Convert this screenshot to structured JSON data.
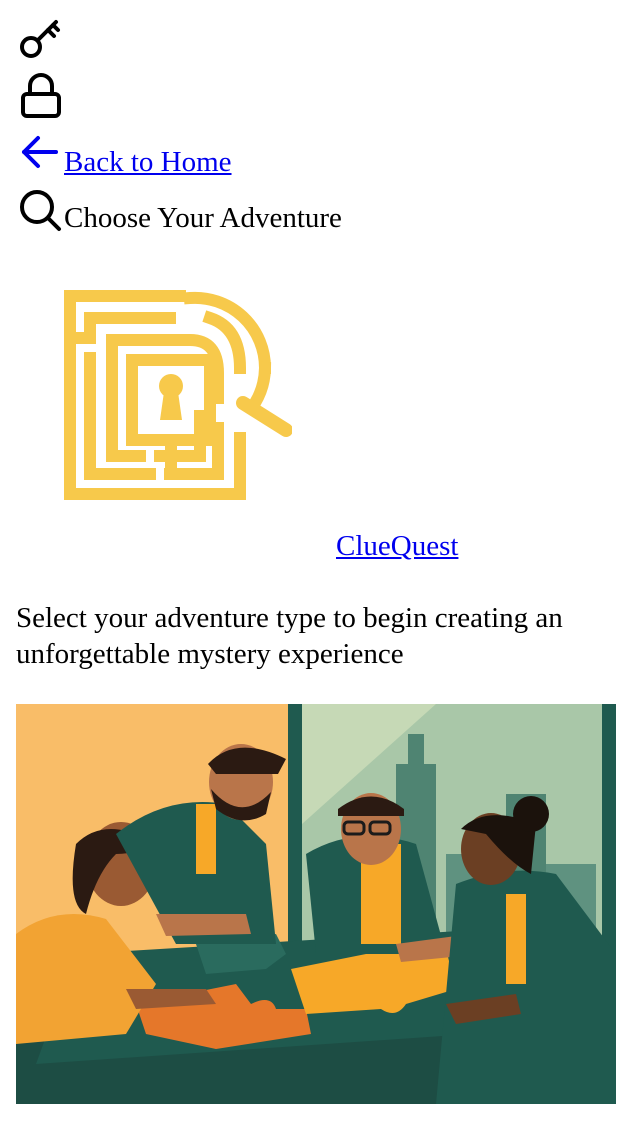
{
  "nav": {
    "back_label": "Back to Home",
    "section_title": "Choose Your Adventure"
  },
  "icons": {
    "key": "key-icon",
    "lock": "lock-icon",
    "back": "arrow-left-icon",
    "search": "search-icon"
  },
  "brand": {
    "name": "ClueQuest",
    "logo_color": "#f7c94b"
  },
  "intro": {
    "text": "Select your adventure type to begin creating an unforgettable mystery experience"
  },
  "hero": {
    "image": "team-solving-puzzle-illustration"
  },
  "colors": {
    "link": "#0000ee",
    "teal": "#1f5a4f",
    "orange": "#f39c2b",
    "background": "#ffffff"
  }
}
